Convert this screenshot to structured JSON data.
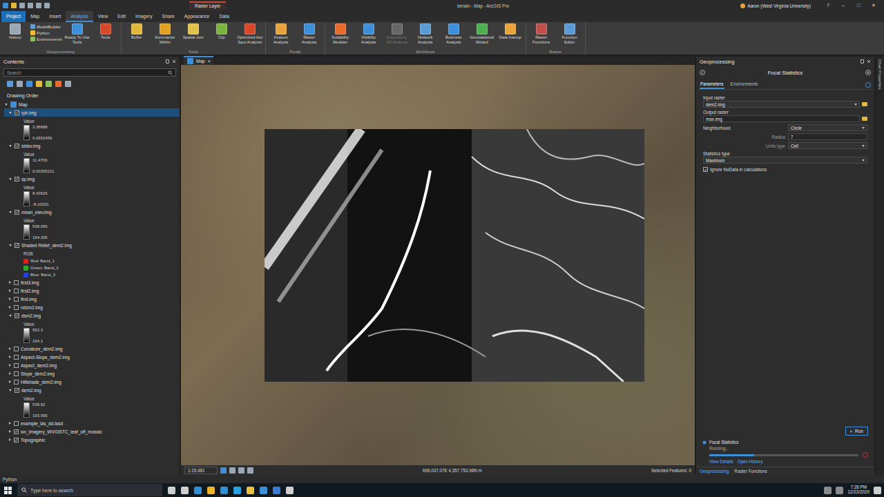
{
  "titlebar": {
    "context_tab": "Raster Layer",
    "title": "terrain - Map - ArcGIS Pro",
    "user": "Aaron (West Virginia University)",
    "help": "?",
    "controls": [
      "–",
      "□",
      "✕"
    ]
  },
  "ribbon": {
    "tabs": [
      {
        "label": "Project",
        "kind": "backstage",
        "selected": false
      },
      {
        "label": "Map",
        "kind": "tab",
        "selected": false
      },
      {
        "label": "Insert",
        "kind": "tab",
        "selected": false
      },
      {
        "label": "Analysis",
        "kind": "tab",
        "selected": true
      },
      {
        "label": "View",
        "kind": "tab",
        "selected": false
      },
      {
        "label": "Edit",
        "kind": "tab",
        "selected": false
      },
      {
        "label": "Imagery",
        "kind": "tab",
        "selected": false
      },
      {
        "label": "Share",
        "kind": "tab",
        "selected": false
      },
      {
        "label": "Appearance",
        "kind": "tab",
        "selected": false
      },
      {
        "label": "Data",
        "kind": "tab",
        "selected": false
      }
    ],
    "groups": [
      {
        "label": "Geoprocessing",
        "items": [
          {
            "label": "History",
            "kind": "large",
            "disabled": false,
            "color": "#9aa7b5"
          },
          {
            "label": "ModelBuilder",
            "kind": "small",
            "disabled": false,
            "color": "#5b9bd5"
          },
          {
            "label": "Python",
            "kind": "small",
            "disabled": false,
            "color": "#f2c037"
          },
          {
            "label": "Environments",
            "kind": "small",
            "disabled": false,
            "color": "#8fbf5a"
          },
          {
            "label": "Ready To Use Tools",
            "kind": "large",
            "disabled": false,
            "color": "#3c8fd8"
          },
          {
            "label": "Tools",
            "kind": "large",
            "disabled": false,
            "color": "#d9472b"
          }
        ]
      },
      {
        "label": "Tools",
        "items": [
          {
            "label": "Buffer",
            "kind": "large",
            "disabled": false,
            "color": "#e2b93b"
          },
          {
            "label": "Summarize Within",
            "kind": "large",
            "disabled": false,
            "color": "#e0a020"
          },
          {
            "label": "Spatial Join",
            "kind": "large",
            "disabled": false,
            "color": "#e2c24b"
          },
          {
            "label": "Clip",
            "kind": "large",
            "disabled": false,
            "color": "#7cb342"
          },
          {
            "label": "Optimized Hot Spot Analysis",
            "kind": "large",
            "disabled": false,
            "color": "#d9472b"
          }
        ]
      },
      {
        "label": "Portal",
        "items": [
          {
            "label": "Feature Analysis",
            "kind": "large",
            "disabled": false,
            "color": "#e8a33a"
          },
          {
            "label": "Raster Analysis",
            "kind": "large",
            "disabled": false,
            "color": "#3c8fd8"
          }
        ]
      },
      {
        "label": "Workflows",
        "items": [
          {
            "label": "Suitability Modeler",
            "kind": "large",
            "disabled": false,
            "color": "#e86a2c"
          },
          {
            "label": "Visibility Analysis",
            "kind": "large",
            "disabled": false,
            "color": "#3c8fd8"
          },
          {
            "label": "Exploratory 3D Analysis",
            "kind": "large",
            "disabled": true,
            "color": "#666666"
          },
          {
            "label": "Network Analysis",
            "kind": "large",
            "disabled": false,
            "color": "#5b9bd5"
          },
          {
            "label": "Business Analysis",
            "kind": "large",
            "disabled": false,
            "color": "#3c8fd8"
          },
          {
            "label": "Geostatistical Wizard",
            "kind": "large",
            "disabled": false,
            "color": "#4caf50"
          },
          {
            "label": "Data Interop",
            "kind": "large",
            "disabled": false,
            "color": "#e8a33a"
          }
        ]
      },
      {
        "label": "Raster",
        "items": [
          {
            "label": "Raster Functions",
            "kind": "large",
            "disabled": false,
            "color": "#c0504d"
          },
          {
            "label": "Function Editor",
            "kind": "large",
            "disabled": false,
            "color": "#5b9bd5"
          }
        ]
      }
    ]
  },
  "contents": {
    "title": "Contents",
    "search_placeholder": "Search",
    "section": "Drawing Order",
    "map": {
      "name": "Map",
      "expanded": true
    },
    "layers": [
      {
        "name": "rph.img",
        "checked": true,
        "selected": true,
        "expanded": true,
        "kind": "value",
        "legend_label": "Value",
        "high": "3.38688",
        "low": "0.0552459"
      },
      {
        "name": "stdev.img",
        "checked": true,
        "selected": false,
        "expanded": true,
        "kind": "value",
        "legend_label": "Value",
        "high": "11.4709",
        "low": "0.00305211"
      },
      {
        "name": "sp.img",
        "checked": true,
        "selected": false,
        "expanded": true,
        "kind": "value",
        "legend_label": "Value",
        "high": "8.43626",
        "low": "-8.10251"
      },
      {
        "name": "mean_elev.img",
        "checked": true,
        "selected": false,
        "expanded": true,
        "kind": "value",
        "legend_label": "Value",
        "high": "538.059",
        "low": "194.305"
      },
      {
        "name": "Shaded Relief_dem2.img",
        "checked": true,
        "selected": false,
        "expanded": true,
        "kind": "rgb",
        "legend_label": "RGB",
        "bands": [
          {
            "label": "Red: Band_1",
            "color": "#e02020"
          },
          {
            "label": "Green: Band_2",
            "color": "#20b020"
          },
          {
            "label": "Blue: Band_3",
            "color": "#2040e0"
          }
        ]
      },
      {
        "name": "first3.img",
        "checked": false,
        "selected": false,
        "expanded": false,
        "kind": "plain"
      },
      {
        "name": "first2.img",
        "checked": false,
        "selected": false,
        "expanded": false,
        "kind": "plain"
      },
      {
        "name": "first.img",
        "checked": false,
        "selected": false,
        "expanded": false,
        "kind": "plain"
      },
      {
        "name": "ndsm2.img",
        "checked": false,
        "selected": false,
        "expanded": false,
        "kind": "plain"
      },
      {
        "name": "dsm2.img",
        "checked": true,
        "selected": false,
        "expanded": true,
        "kind": "value",
        "legend_label": "Value",
        "high": "552.3",
        "low": "194.1"
      },
      {
        "name": "Curvature_dem2.img",
        "checked": false,
        "selected": false,
        "expanded": false,
        "kind": "plain"
      },
      {
        "name": "Aspect-Slope_dem2.img",
        "checked": false,
        "selected": false,
        "expanded": false,
        "kind": "plain"
      },
      {
        "name": "Aspect_dem2.img",
        "checked": false,
        "selected": false,
        "expanded": false,
        "kind": "plain"
      },
      {
        "name": "Slope_dem2.img",
        "checked": false,
        "selected": false,
        "expanded": false,
        "kind": "plain"
      },
      {
        "name": "Hillshade_dem2.img",
        "checked": false,
        "selected": false,
        "expanded": false,
        "kind": "plain"
      },
      {
        "name": "dem2.img",
        "checked": true,
        "selected": false,
        "expanded": true,
        "kind": "value",
        "legend_label": "Value",
        "high": "538.52",
        "low": "193.995"
      },
      {
        "name": "example_las_dd.lasd",
        "checked": false,
        "selected": false,
        "expanded": false,
        "kind": "plain"
      },
      {
        "name": "wv_imagery_WVGISTC_leaf_off_mosaic",
        "checked": true,
        "selected": false,
        "expanded": false,
        "kind": "plain"
      },
      {
        "name": "Topographic",
        "checked": true,
        "selected": false,
        "expanded": false,
        "kind": "plain"
      }
    ]
  },
  "map_view": {
    "tab": "Map",
    "close": "×",
    "scale": "1:15,481",
    "coordinates": "696,037.07E 4,357,753.98N m",
    "selected_features": "Selected Features: 0"
  },
  "geoprocessing": {
    "title": "Geoprocessing",
    "tool": "Focal Statistics",
    "tabs": [
      {
        "label": "Parameters",
        "selected": true
      },
      {
        "label": "Environments",
        "selected": false
      }
    ],
    "parameters": [
      {
        "label": "Input raster",
        "value": "dem2.img",
        "kind": "stacked",
        "control": "select",
        "browse": true
      },
      {
        "label": "Output raster",
        "value": "max.img",
        "kind": "stacked",
        "control": "field",
        "browse": true
      },
      {
        "label": "Neighborhood",
        "value": "Circle",
        "kind": "inline",
        "control": "select",
        "browse": false
      },
      {
        "label": "Radius",
        "value": "7",
        "kind": "sub",
        "control": "field",
        "browse": false
      },
      {
        "label": "Units type",
        "value": "Cell",
        "kind": "sub",
        "control": "select",
        "browse": false
      },
      {
        "label": "Statistics type",
        "value": "Maximum",
        "kind": "stacked",
        "control": "select",
        "browse": false
      }
    ],
    "checkbox": {
      "label": "Ignore NoData in calculations",
      "checked": true
    },
    "run": "Run",
    "progress": {
      "tool": "Focal Statistics",
      "status": "Running...",
      "level": 0.3,
      "links": [
        "View Details",
        "Open History"
      ]
    },
    "bottom_tabs": [
      {
        "label": "Geoprocessing",
        "selected": true
      },
      {
        "label": "Raster Functions",
        "selected": false
      }
    ]
  },
  "side_strip": "Chart Properties",
  "status_bar": "Python",
  "taskbar": {
    "search_placeholder": "Type here to search",
    "time": "7:28 PM",
    "date": "12/22/2020"
  }
}
